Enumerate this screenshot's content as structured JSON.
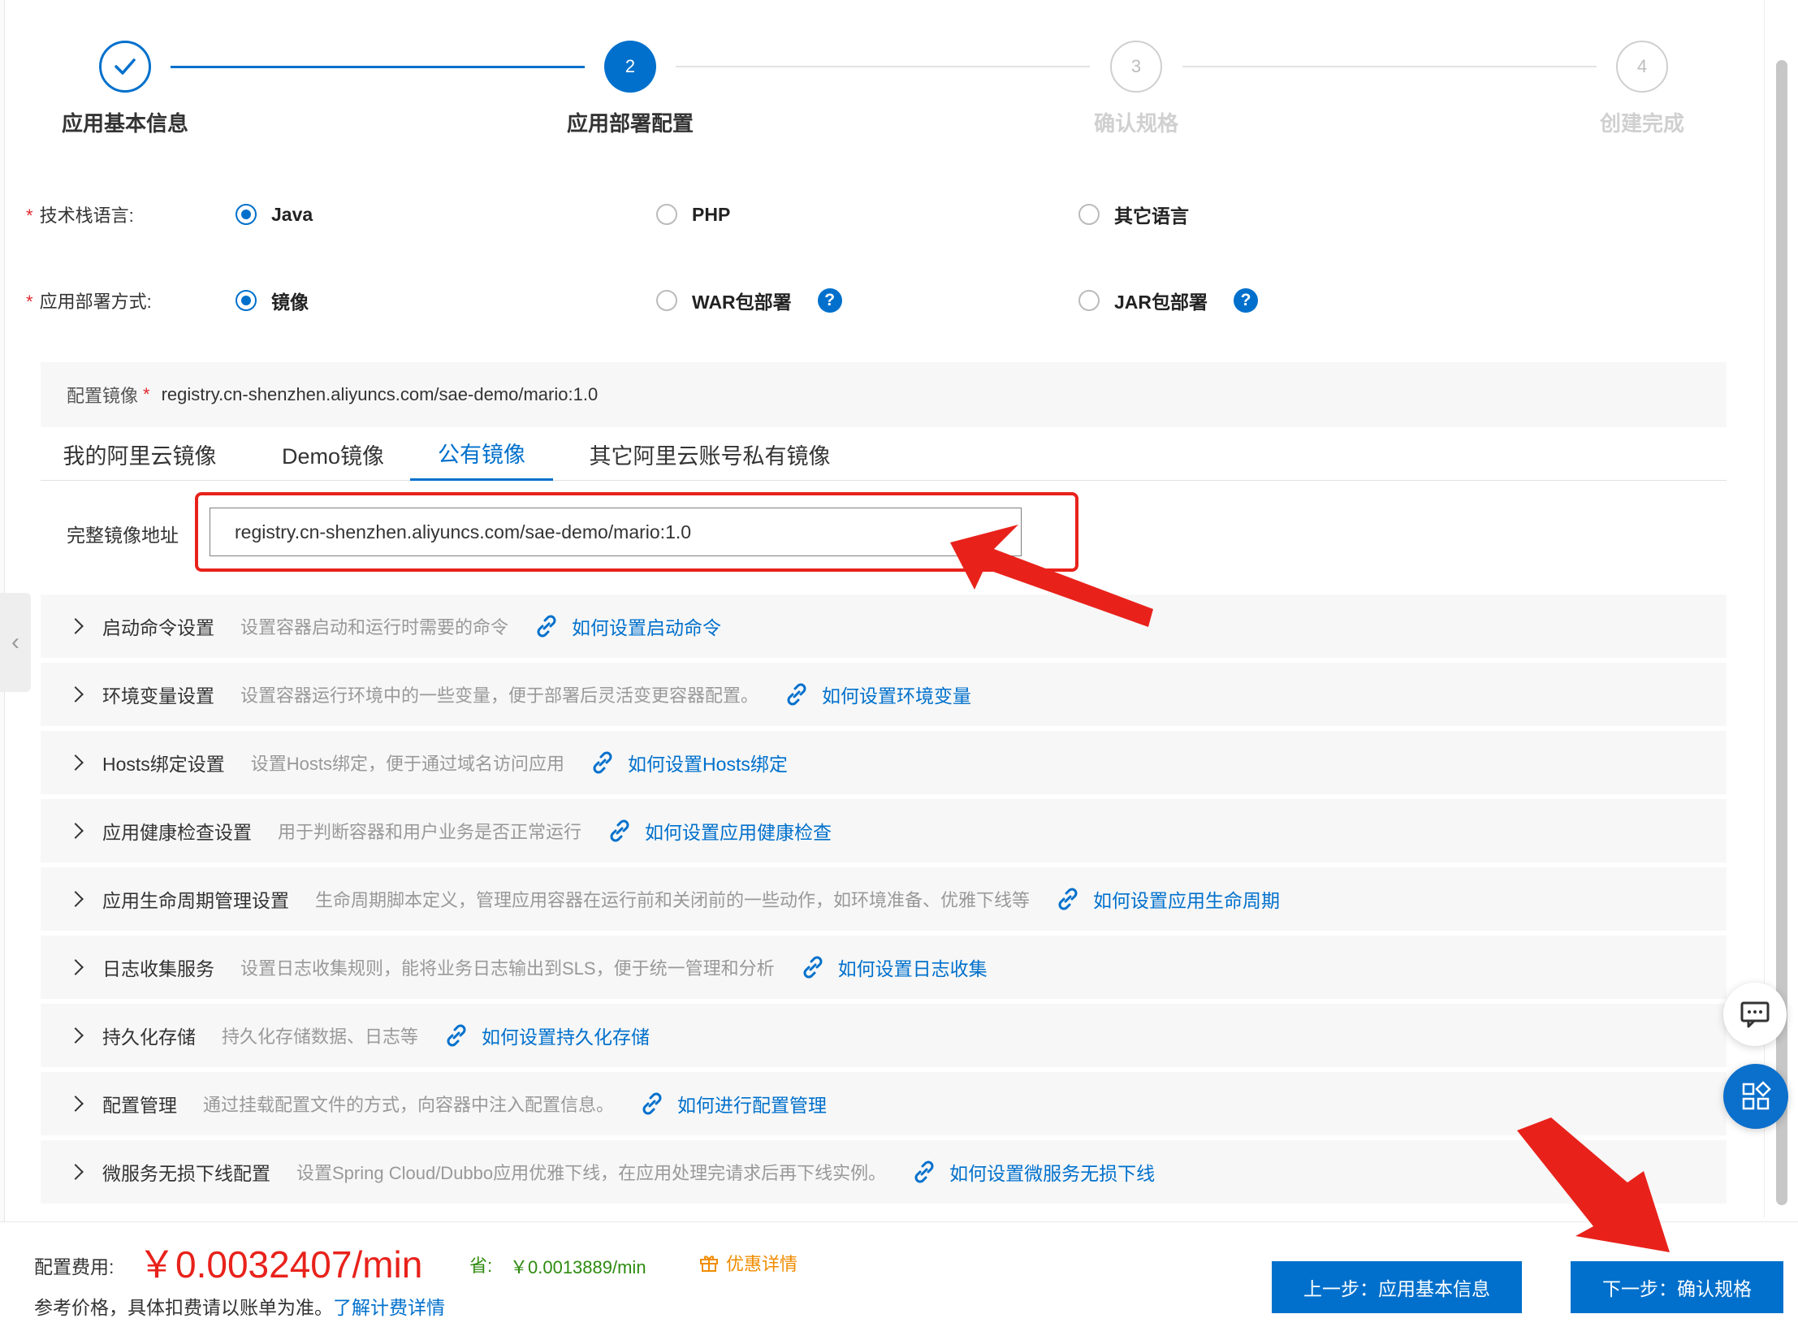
{
  "steps": [
    {
      "number": "",
      "title": "应用基本信息",
      "state": "done"
    },
    {
      "number": "2",
      "title": "应用部署配置",
      "state": "active"
    },
    {
      "number": "3",
      "title": "确认规格",
      "state": "pending"
    },
    {
      "number": "4",
      "title": "创建完成",
      "state": "pending"
    }
  ],
  "tech_stack": {
    "required_mark": "*",
    "label": "技术栈语言:",
    "options": [
      "Java",
      "PHP",
      "其它语言"
    ],
    "selected": "Java"
  },
  "deploy_method": {
    "required_mark": "*",
    "label": "应用部署方式:",
    "options": [
      "镜像",
      "WAR包部署",
      "JAR包部署"
    ],
    "selected": "镜像",
    "help_icon_glyph": "?"
  },
  "image_config": {
    "label": "配置镜像",
    "required_mark": "*",
    "value": "registry.cn-shenzhen.aliyuncs.com/sae-demo/mario:1.0"
  },
  "image_tabs": [
    {
      "label": "我的阿里云镜像"
    },
    {
      "label": "Demo镜像"
    },
    {
      "label": "公有镜像"
    },
    {
      "label": "其它阿里云账号私有镜像"
    }
  ],
  "active_tab": "公有镜像",
  "full_address": {
    "label": "完整镜像地址",
    "value": "registry.cn-shenzhen.aliyuncs.com/sae-demo/mario:1.0"
  },
  "settings": [
    {
      "title": "启动命令设置",
      "desc": "设置容器启动和运行时需要的命令",
      "link": "如何设置启动命令"
    },
    {
      "title": "环境变量设置",
      "desc": "设置容器运行环境中的一些变量，便于部署后灵活变更容器配置。",
      "link": "如何设置环境变量"
    },
    {
      "title": "Hosts绑定设置",
      "desc": "设置Hosts绑定，便于通过域名访问应用",
      "link": "如何设置Hosts绑定"
    },
    {
      "title": "应用健康检查设置",
      "desc": "用于判断容器和用户业务是否正常运行",
      "link": "如何设置应用健康检查"
    },
    {
      "title": "应用生命周期管理设置",
      "desc": "生命周期脚本定义，管理应用容器在运行前和关闭前的一些动作，如环境准备、优雅下线等",
      "link": "如何设置应用生命周期"
    },
    {
      "title": "日志收集服务",
      "desc": "设置日志收集规则，能将业务日志输出到SLS，便于统一管理和分析",
      "link": "如何设置日志收集"
    },
    {
      "title": "持久化存储",
      "desc": "持久化存储数据、日志等",
      "link": "如何设置持久化存储"
    },
    {
      "title": "配置管理",
      "desc": "通过挂载配置文件的方式，向容器中注入配置信息。",
      "link": "如何进行配置管理"
    },
    {
      "title": "微服务无损下线配置",
      "desc": "设置Spring Cloud/Dubbo应用优雅下线，在应用处理完请求后再下线实例。",
      "link": "如何设置微服务无损下线"
    }
  ],
  "footer": {
    "fee_label": "配置费用:",
    "fee_value": "￥0.0032407/min",
    "save_label": "省:",
    "save_value": "￥0.0013889/min",
    "promo_label": "优惠详情",
    "note": "参考价格，具体扣费请以账单为准。",
    "note_link": "了解计费详情",
    "prev_button": "上一步：应用基本信息",
    "next_button": "下一步：确认规格"
  },
  "icons": {
    "step_done": "check-icon",
    "expand": "chevron-right-icon",
    "link": "link-icon",
    "help": "question-circle-icon",
    "promo": "gift-icon",
    "chat": "chat-icon",
    "apps": "apps-grid-icon",
    "collapse": "chevron-left-icon"
  },
  "colors": {
    "primary": "#0070cc",
    "price": "#e8221b",
    "saving": "#2e8b0f",
    "promo": "#f08c00",
    "annotation": "#e8221b"
  }
}
